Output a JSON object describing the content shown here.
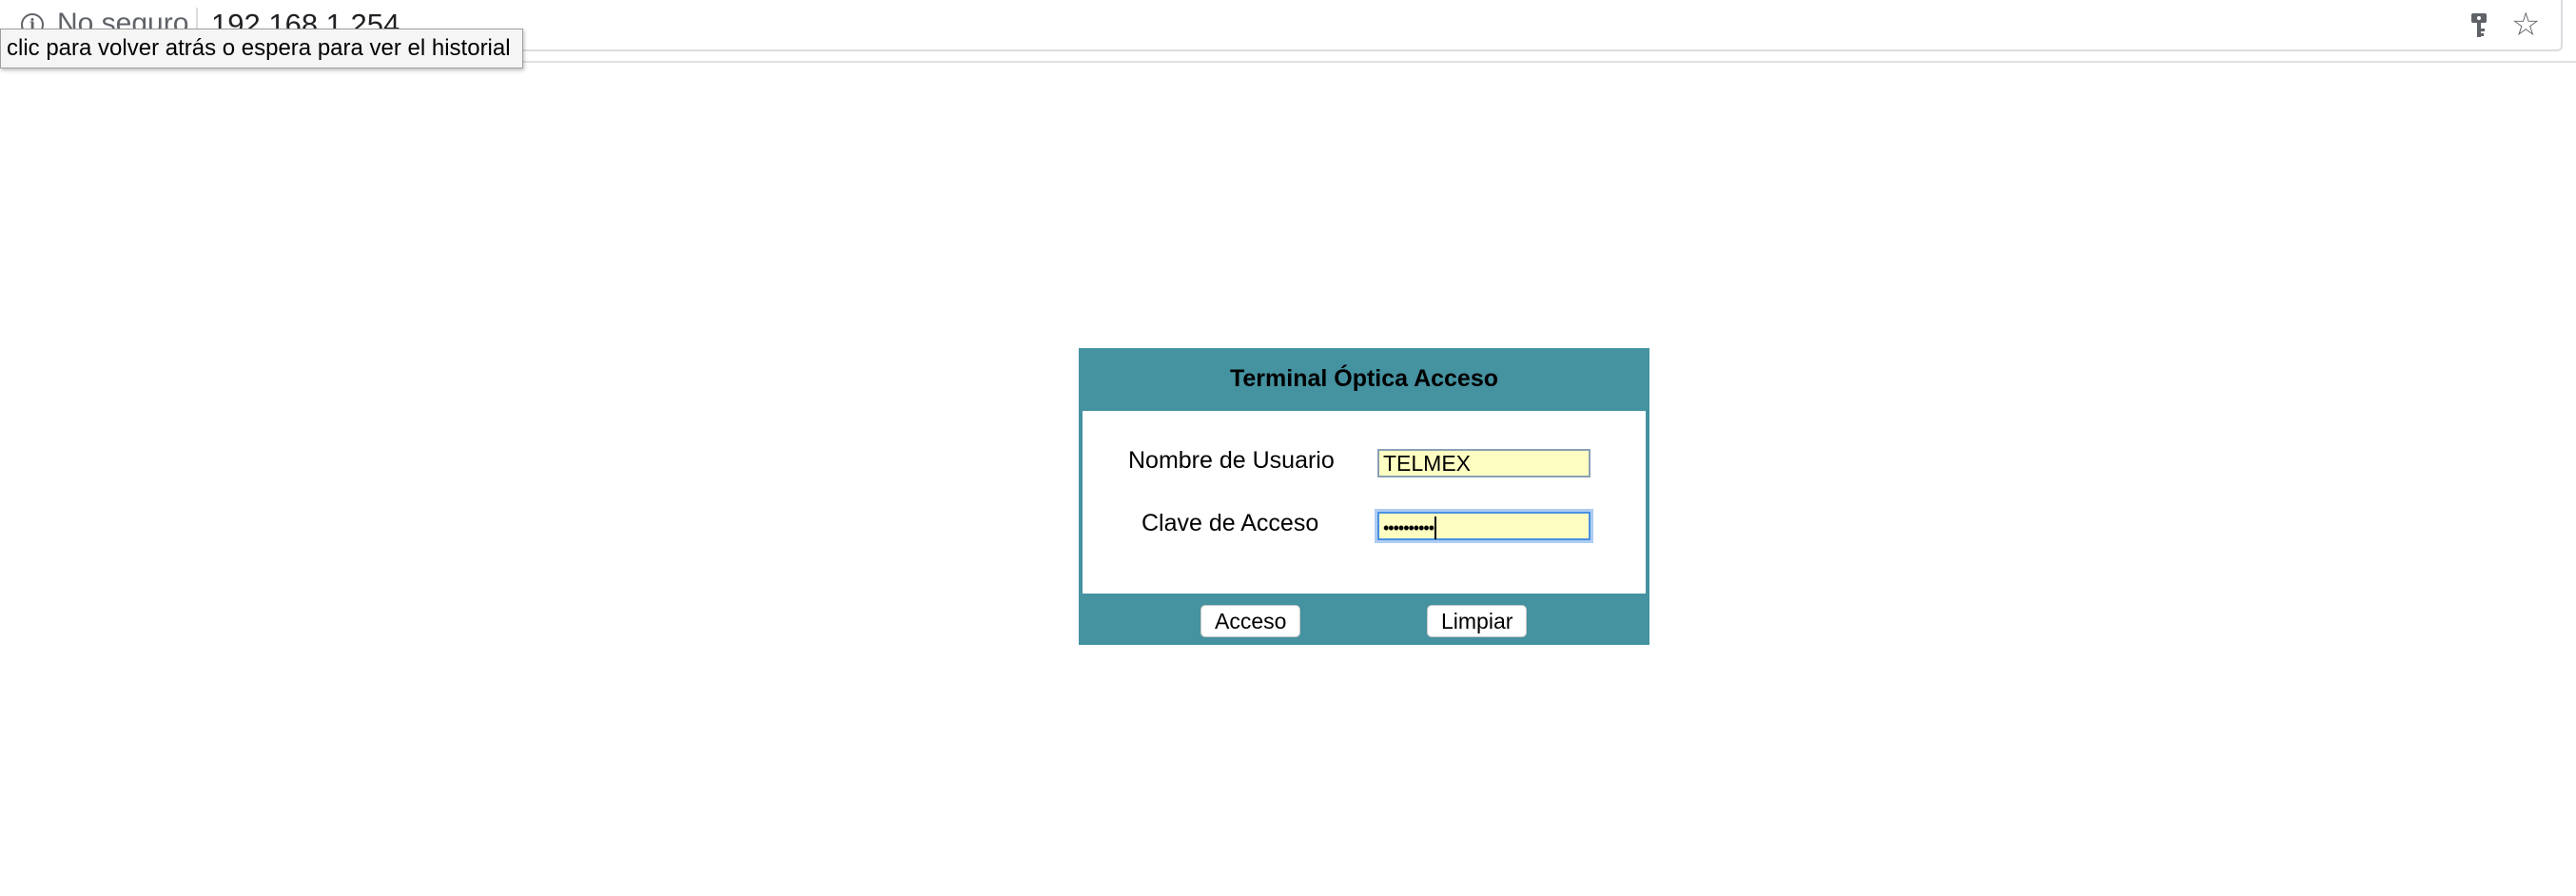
{
  "browser": {
    "security_label": "No seguro",
    "url": "192.168.1.254",
    "back_tooltip": "clic para volver atrás o espera para ver el historial",
    "icons": {
      "info": "info-icon",
      "password_key": "key-icon",
      "bookmark": "star-icon"
    }
  },
  "login": {
    "title": "Terminal Óptica Acceso",
    "username_label": "Nombre de Usuario",
    "username_value": "TELMEX",
    "password_label": "Clave de Acceso",
    "password_mask": "••••••••••",
    "submit_label": "Acceso",
    "reset_label": "Limpiar"
  },
  "colors": {
    "panel": "#4592a0",
    "input_background": "#fffec2",
    "focus_ring": "#4a90e2"
  }
}
